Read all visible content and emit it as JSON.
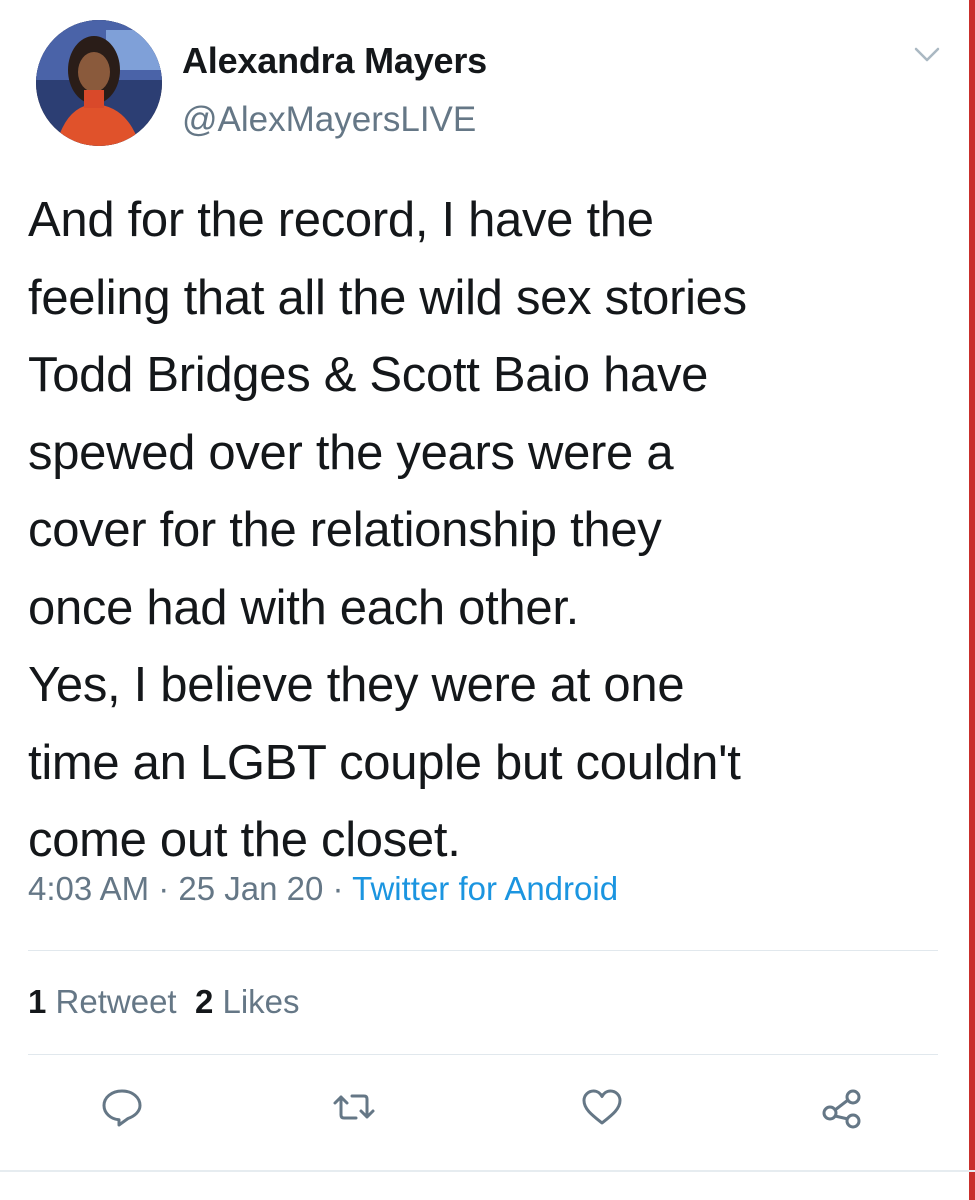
{
  "tweet": {
    "author_name": "Alexandra Mayers",
    "author_handle": "@AlexMayersLIVE",
    "text": "And for the record, I have the\nfeeling that all the wild sex stories\nTodd Bridges & Scott Baio have\nspewed over the years were a\ncover for the relationship they\nonce had with each other.\nYes, I believe they were at one\ntime an LGBT couple but couldn't\ncome out the closet.",
    "time": "4:03 AM",
    "date": "25 Jan 20",
    "source": "Twitter for Android",
    "separator": " · "
  },
  "stats": {
    "retweet_count": "1",
    "retweet_label": "Retweet",
    "like_count": "2",
    "like_label": "Likes"
  },
  "actions": [
    {
      "icon": "reply-icon"
    },
    {
      "icon": "retweet-icon"
    },
    {
      "icon": "like-icon"
    },
    {
      "icon": "share-icon"
    }
  ],
  "colors": {
    "text": "#14171a",
    "secondary": "#657786",
    "link": "#1b95e0",
    "divider": "#e1e8ed"
  }
}
